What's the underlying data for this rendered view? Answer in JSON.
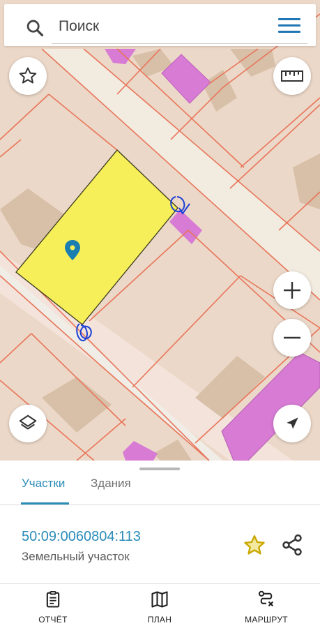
{
  "search": {
    "placeholder": "Поиск"
  },
  "colors": {
    "accent": "#2b8cb8",
    "selected_parcel_fill": "#f6ef5a",
    "building_fill": "#d678d2",
    "parcel_boundary": "#e8755a",
    "star_fill": "#e6c600"
  },
  "map_controls": {
    "favorites": "star-outline-icon",
    "ruler": "ruler-icon",
    "zoom_in": "plus-icon",
    "zoom_out": "minus-icon",
    "layers": "layers-icon",
    "locate": "navigation-arrow-icon"
  },
  "tabs": [
    {
      "label": "Участки",
      "active": true
    },
    {
      "label": "Здания",
      "active": false
    }
  ],
  "result": {
    "cadastral_number": "50:09:0060804:113",
    "type": "Земельный участок"
  },
  "nav": [
    {
      "label": "ОТЧЁТ",
      "icon": "report-clipboard-icon"
    },
    {
      "label": "ПЛАН",
      "icon": "map-plan-icon"
    },
    {
      "label": "МАРШРУТ",
      "icon": "route-icon"
    }
  ]
}
